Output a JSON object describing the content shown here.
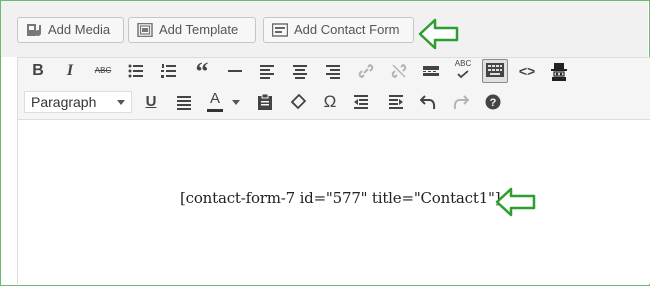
{
  "media_buttons": {
    "add_media": "Add Media",
    "add_template": "Add Template",
    "add_contact_form": "Add Contact Form"
  },
  "toolbar": {
    "format_select": "Paragraph",
    "bold": "B",
    "italic": "I",
    "strikethrough": "ABC",
    "blockquote": "“",
    "omega": "Ω",
    "text_color": "A",
    "code": "<>",
    "spellcheck": "ABC"
  },
  "editor": {
    "content": "[contact-form-7 id=\"577\" title=\"Contact1\"]"
  },
  "colors": {
    "arrow": "#2e9e2e",
    "frame": "#6fb96f"
  }
}
